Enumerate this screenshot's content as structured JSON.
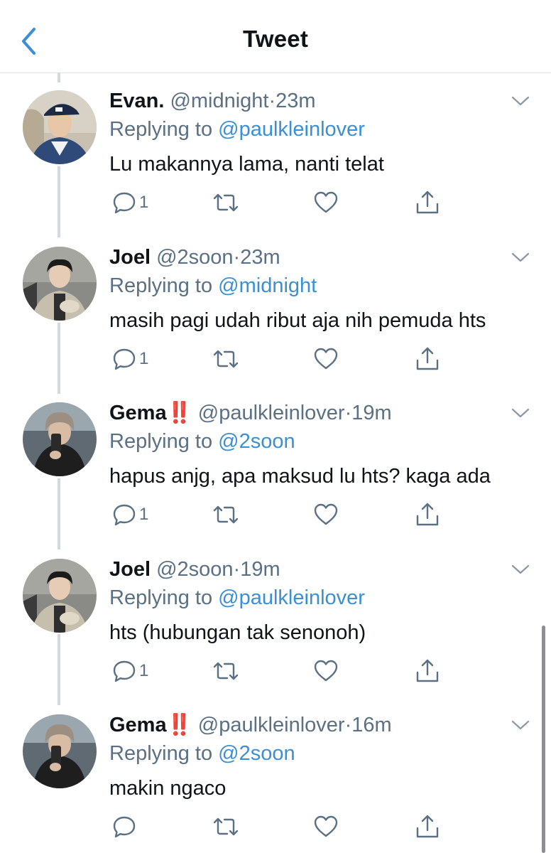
{
  "header": {
    "title": "Tweet"
  },
  "tweets": [
    {
      "name": "Evan.",
      "badge": "",
      "handle": "@midnight",
      "sep": "·",
      "time": "23m",
      "replying_prefix": "Replying to",
      "replying_to": "@paulkleinlover",
      "text": "Lu makannya lama, nanti telat",
      "reply_count": "1"
    },
    {
      "name": "Joel",
      "badge": "",
      "handle": "@2soon",
      "sep": "·",
      "time": "23m",
      "replying_prefix": "Replying to",
      "replying_to": "@midnight",
      "text": "masih pagi udah ribut aja nih pemuda hts",
      "reply_count": "1"
    },
    {
      "name": "Gema",
      "badge": "‼️",
      "handle": "@paulkleinlover",
      "sep": "·",
      "time": "19m",
      "replying_prefix": "Replying to",
      "replying_to": "@2soon",
      "text": "hapus anjg, apa maksud lu hts? kaga ada",
      "reply_count": "1"
    },
    {
      "name": "Joel",
      "badge": "",
      "handle": "@2soon",
      "sep": "·",
      "time": "19m",
      "replying_prefix": "Replying to",
      "replying_to": "@paulkleinlover",
      "text": "hts (hubungan tak senonoh)",
      "reply_count": "1"
    },
    {
      "name": "Gema",
      "badge": "‼️",
      "handle": "@paulkleinlover",
      "sep": "·",
      "time": "16m",
      "replying_prefix": "Replying to",
      "replying_to": "@2soon",
      "text": "makin ngaco",
      "reply_count": ""
    }
  ],
  "icons": {
    "back": "chevron-left-icon",
    "more": "chevron-down-icon",
    "reply": "reply-icon",
    "retweet": "retweet-icon",
    "like": "heart-icon",
    "share": "share-icon"
  },
  "colors": {
    "accent": "#3a8fd6",
    "muted": "#5b7083",
    "badge": "#e0245e",
    "thread_line": "#cfd9de"
  }
}
